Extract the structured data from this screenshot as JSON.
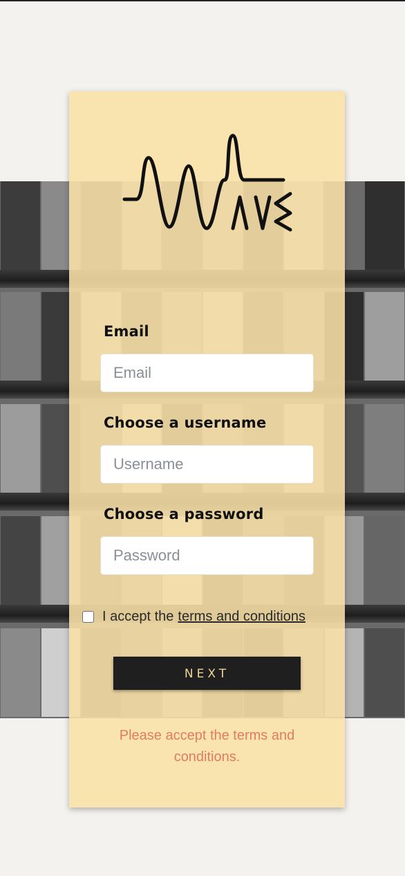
{
  "form": {
    "email_label": "Email",
    "email_placeholder": "Email",
    "username_label": "Choose a username",
    "username_placeholder": "Username",
    "password_label": "Choose a password",
    "password_placeholder": "Password",
    "terms_prefix": "I accept the",
    "terms_link": "terms and conditions",
    "terms_checked": false,
    "next_label": "NEXT",
    "error_message": "Please accept the terms and conditions."
  },
  "logo": {
    "name": "wave-logo",
    "stroke": "#111111"
  },
  "colors": {
    "card_background": "#f9e0a6",
    "button_background": "#1f1f1f",
    "button_text": "#f0d596",
    "error_text": "#e07c63",
    "page_background": "#f4f2ee"
  }
}
